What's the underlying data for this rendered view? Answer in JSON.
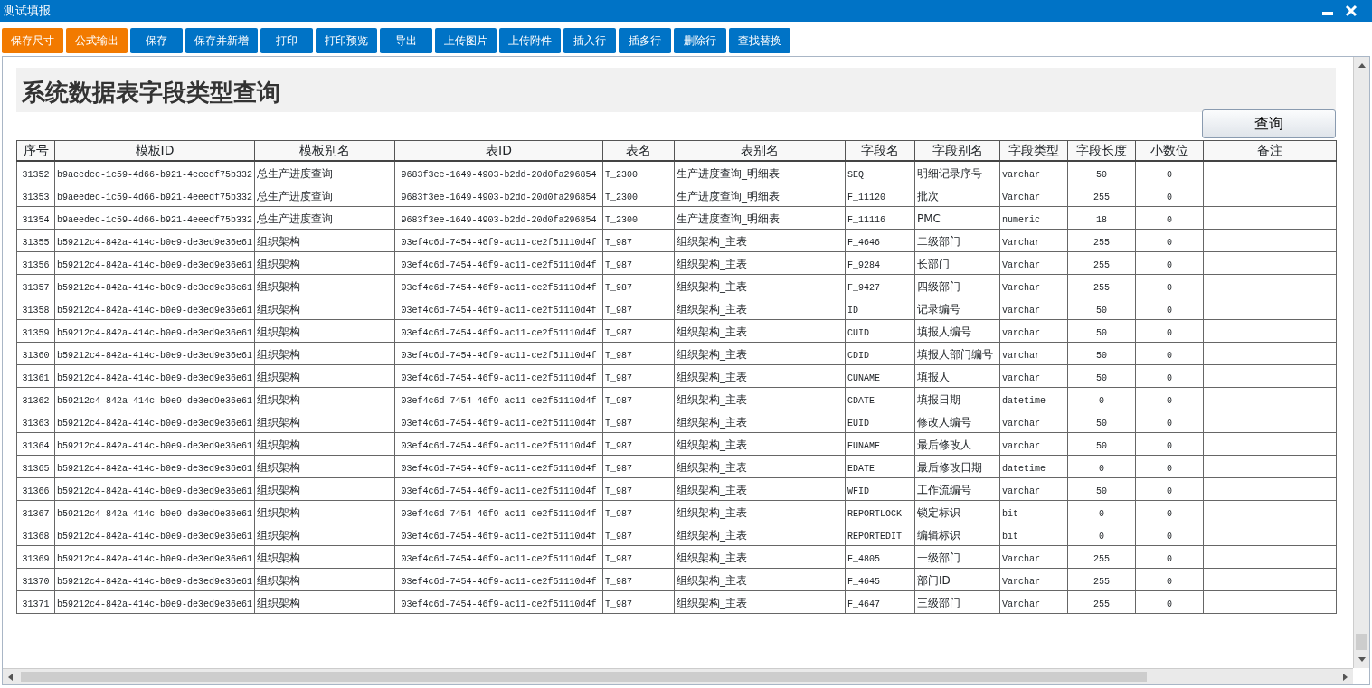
{
  "window": {
    "title": "测试填报"
  },
  "toolbar": [
    {
      "label": "保存尺寸",
      "color": "#f27a00"
    },
    {
      "label": "公式输出",
      "color": "#f27a00"
    },
    {
      "label": "保存",
      "color": "#0073c6"
    },
    {
      "label": "保存并新增",
      "color": "#0073c6"
    },
    {
      "label": "打印",
      "color": "#0073c6"
    },
    {
      "label": "打印预览",
      "color": "#0073c6"
    },
    {
      "label": "导出",
      "color": "#0073c6"
    },
    {
      "label": "上传图片",
      "color": "#0073c6"
    },
    {
      "label": "上传附件",
      "color": "#0073c6"
    },
    {
      "label": "插入行",
      "color": "#0073c6"
    },
    {
      "label": "插多行",
      "color": "#0073c6"
    },
    {
      "label": "删除行",
      "color": "#0073c6"
    },
    {
      "label": "查找替换",
      "color": "#0073c6"
    }
  ],
  "report": {
    "heading": "系统数据表字段类型查询",
    "query_button": "查询"
  },
  "table": {
    "columns": [
      "序号",
      "模板ID",
      "模板别名",
      "表ID",
      "表名",
      "表别名",
      "字段名",
      "字段别名",
      "字段类型",
      "字段长度",
      "小数位",
      "备注"
    ],
    "rows": [
      [
        "31352",
        "b9aeedec-1c59-4d66-b921-4eeedf75b332",
        "总生产进度查询",
        "9683f3ee-1649-4903-b2dd-20d0fa296854",
        "T_2300",
        "生产进度查询_明细表",
        "SEQ",
        "明细记录序号",
        "varchar",
        "50",
        "0"
      ],
      [
        "31353",
        "b9aeedec-1c59-4d66-b921-4eeedf75b332",
        "总生产进度查询",
        "9683f3ee-1649-4903-b2dd-20d0fa296854",
        "T_2300",
        "生产进度查询_明细表",
        "F_11120",
        "批次",
        "Varchar",
        "255",
        "0"
      ],
      [
        "31354",
        "b9aeedec-1c59-4d66-b921-4eeedf75b332",
        "总生产进度查询",
        "9683f3ee-1649-4903-b2dd-20d0fa296854",
        "T_2300",
        "生产进度查询_明细表",
        "F_11116",
        "PMC",
        "numeric",
        "18",
        "0"
      ],
      [
        "31355",
        "b59212c4-842a-414c-b0e9-de3ed9e36e61",
        "组织架构",
        "03ef4c6d-7454-46f9-ac11-ce2f51110d4f",
        "T_987",
        "组织架构_主表",
        "F_4646",
        "二级部门",
        "Varchar",
        "255",
        "0"
      ],
      [
        "31356",
        "b59212c4-842a-414c-b0e9-de3ed9e36e61",
        "组织架构",
        "03ef4c6d-7454-46f9-ac11-ce2f51110d4f",
        "T_987",
        "组织架构_主表",
        "F_9284",
        "长部门",
        "Varchar",
        "255",
        "0"
      ],
      [
        "31357",
        "b59212c4-842a-414c-b0e9-de3ed9e36e61",
        "组织架构",
        "03ef4c6d-7454-46f9-ac11-ce2f51110d4f",
        "T_987",
        "组织架构_主表",
        "F_9427",
        "四级部门",
        "Varchar",
        "255",
        "0"
      ],
      [
        "31358",
        "b59212c4-842a-414c-b0e9-de3ed9e36e61",
        "组织架构",
        "03ef4c6d-7454-46f9-ac11-ce2f51110d4f",
        "T_987",
        "组织架构_主表",
        "ID",
        "记录编号",
        "varchar",
        "50",
        "0"
      ],
      [
        "31359",
        "b59212c4-842a-414c-b0e9-de3ed9e36e61",
        "组织架构",
        "03ef4c6d-7454-46f9-ac11-ce2f51110d4f",
        "T_987",
        "组织架构_主表",
        "CUID",
        "填报人编号",
        "varchar",
        "50",
        "0"
      ],
      [
        "31360",
        "b59212c4-842a-414c-b0e9-de3ed9e36e61",
        "组织架构",
        "03ef4c6d-7454-46f9-ac11-ce2f51110d4f",
        "T_987",
        "组织架构_主表",
        "CDID",
        "填报人部门编号",
        "varchar",
        "50",
        "0"
      ],
      [
        "31361",
        "b59212c4-842a-414c-b0e9-de3ed9e36e61",
        "组织架构",
        "03ef4c6d-7454-46f9-ac11-ce2f51110d4f",
        "T_987",
        "组织架构_主表",
        "CUNAME",
        "填报人",
        "varchar",
        "50",
        "0"
      ],
      [
        "31362",
        "b59212c4-842a-414c-b0e9-de3ed9e36e61",
        "组织架构",
        "03ef4c6d-7454-46f9-ac11-ce2f51110d4f",
        "T_987",
        "组织架构_主表",
        "CDATE",
        "填报日期",
        "datetime",
        "0",
        "0"
      ],
      [
        "31363",
        "b59212c4-842a-414c-b0e9-de3ed9e36e61",
        "组织架构",
        "03ef4c6d-7454-46f9-ac11-ce2f51110d4f",
        "T_987",
        "组织架构_主表",
        "EUID",
        "修改人编号",
        "varchar",
        "50",
        "0"
      ],
      [
        "31364",
        "b59212c4-842a-414c-b0e9-de3ed9e36e61",
        "组织架构",
        "03ef4c6d-7454-46f9-ac11-ce2f51110d4f",
        "T_987",
        "组织架构_主表",
        "EUNAME",
        "最后修改人",
        "varchar",
        "50",
        "0"
      ],
      [
        "31365",
        "b59212c4-842a-414c-b0e9-de3ed9e36e61",
        "组织架构",
        "03ef4c6d-7454-46f9-ac11-ce2f51110d4f",
        "T_987",
        "组织架构_主表",
        "EDATE",
        "最后修改日期",
        "datetime",
        "0",
        "0"
      ],
      [
        "31366",
        "b59212c4-842a-414c-b0e9-de3ed9e36e61",
        "组织架构",
        "03ef4c6d-7454-46f9-ac11-ce2f51110d4f",
        "T_987",
        "组织架构_主表",
        "WFID",
        "工作流编号",
        "varchar",
        "50",
        "0"
      ],
      [
        "31367",
        "b59212c4-842a-414c-b0e9-de3ed9e36e61",
        "组织架构",
        "03ef4c6d-7454-46f9-ac11-ce2f51110d4f",
        "T_987",
        "组织架构_主表",
        "REPORTLOCK",
        "锁定标识",
        "bit",
        "0",
        "0"
      ],
      [
        "31368",
        "b59212c4-842a-414c-b0e9-de3ed9e36e61",
        "组织架构",
        "03ef4c6d-7454-46f9-ac11-ce2f51110d4f",
        "T_987",
        "组织架构_主表",
        "REPORTEDIT",
        "编辑标识",
        "bit",
        "0",
        "0"
      ],
      [
        "31369",
        "b59212c4-842a-414c-b0e9-de3ed9e36e61",
        "组织架构",
        "03ef4c6d-7454-46f9-ac11-ce2f51110d4f",
        "T_987",
        "组织架构_主表",
        "F_4805",
        "一级部门",
        "Varchar",
        "255",
        "0"
      ],
      [
        "31370",
        "b59212c4-842a-414c-b0e9-de3ed9e36e61",
        "组织架构",
        "03ef4c6d-7454-46f9-ac11-ce2f51110d4f",
        "T_987",
        "组织架构_主表",
        "F_4645",
        "部门ID",
        "Varchar",
        "255",
        "0"
      ],
      [
        "31371",
        "b59212c4-842a-414c-b0e9-de3ed9e36e61",
        "组织架构",
        "03ef4c6d-7454-46f9-ac11-ce2f51110d4f",
        "T_987",
        "组织架构_主表",
        "F_4647",
        "三级部门",
        "Varchar",
        "255",
        "0"
      ]
    ]
  }
}
